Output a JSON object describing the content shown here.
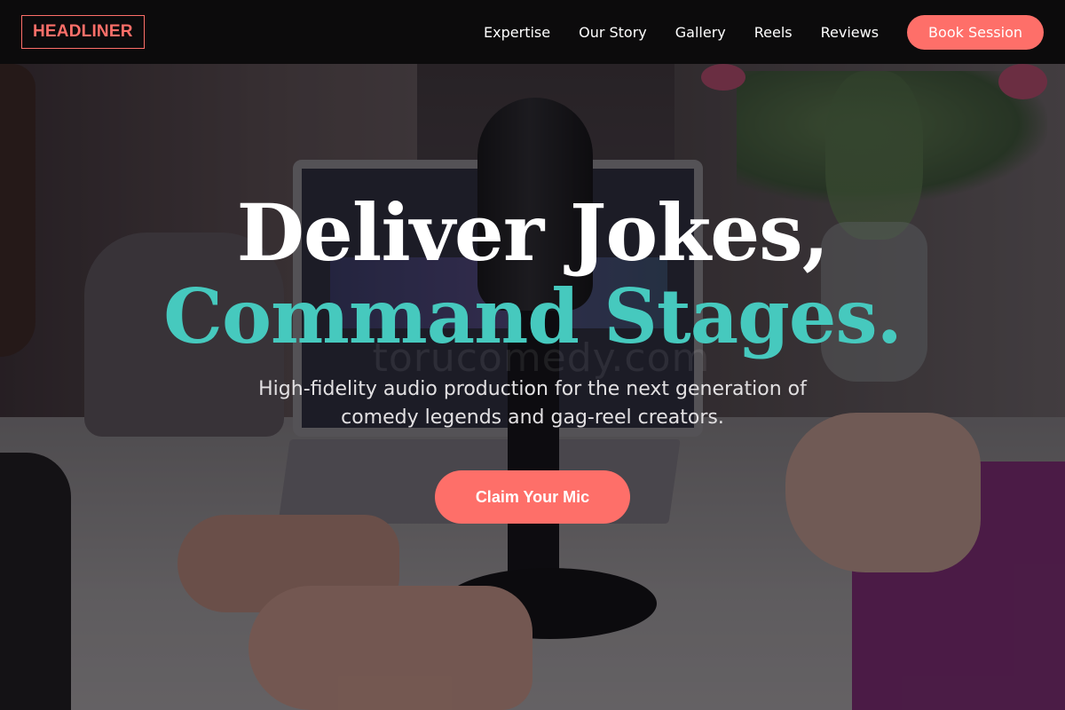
{
  "header": {
    "logo": "HEADLINER",
    "nav": [
      {
        "label": "Expertise"
      },
      {
        "label": "Our Story"
      },
      {
        "label": "Gallery"
      },
      {
        "label": "Reels"
      },
      {
        "label": "Reviews"
      }
    ],
    "book_label": "Book Session"
  },
  "hero": {
    "headline_line1": "Deliver Jokes,",
    "headline_line2": "Command Stages.",
    "subtitle": "High-fidelity audio production for the next generation of comedy legends and gag-reel creators.",
    "cta_label": "Claim Your Mic",
    "watermark": "torucomedy.com"
  },
  "colors": {
    "accent": "#fe6f69",
    "teal": "#46c9be",
    "header_bg": "#0c0b0c"
  }
}
